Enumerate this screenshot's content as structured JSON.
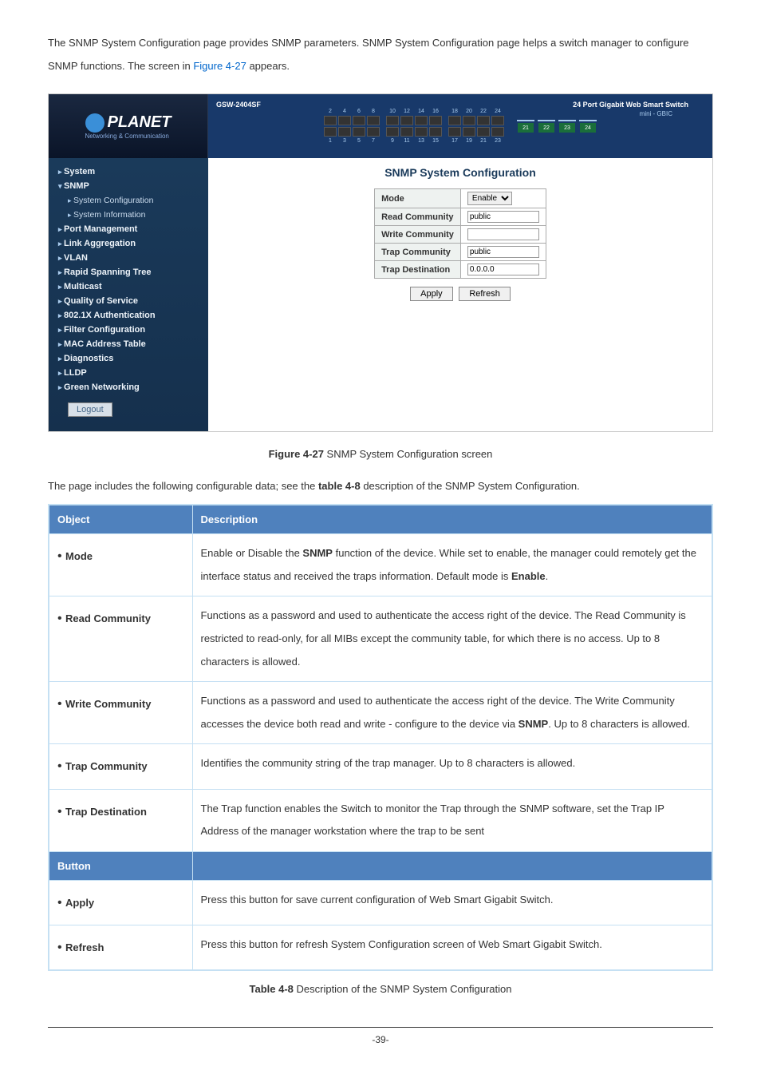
{
  "intro": {
    "text_before": "The SNMP System Configuration page provides SNMP parameters. SNMP System Configuration page helps a switch manager to configure SNMP functions. The screen in ",
    "link": "Figure 4-27",
    "text_after": " appears."
  },
  "screenshot": {
    "model": "GSW-2404SF",
    "header_title": "24 Port Gigabit Web Smart Switch",
    "header_sub": "mini - GBIC",
    "logo_text": "PLANET",
    "logo_sub": "Networking & Communication",
    "port_numbers_top": [
      "2",
      "4",
      "6",
      "8",
      "10",
      "12",
      "14",
      "16",
      "18",
      "20",
      "22",
      "24"
    ],
    "port_numbers_bottom": [
      "1",
      "3",
      "5",
      "7",
      "9",
      "11",
      "13",
      "15",
      "17",
      "19",
      "21",
      "23"
    ],
    "gbic_labels": [
      "21",
      "22",
      "23",
      "24"
    ],
    "nav": [
      {
        "label": "System",
        "expanded": false
      },
      {
        "label": "SNMP",
        "expanded": true
      },
      {
        "label": "System Configuration",
        "sub": true
      },
      {
        "label": "System Information",
        "sub": true
      },
      {
        "label": "Port Management"
      },
      {
        "label": "Link Aggregation"
      },
      {
        "label": "VLAN"
      },
      {
        "label": "Rapid Spanning Tree"
      },
      {
        "label": "Multicast"
      },
      {
        "label": "Quality of Service"
      },
      {
        "label": "802.1X Authentication"
      },
      {
        "label": "Filter Configuration"
      },
      {
        "label": "MAC Address Table"
      },
      {
        "label": "Diagnostics"
      },
      {
        "label": "LLDP"
      },
      {
        "label": "Green Networking"
      }
    ],
    "logout_label": "Logout",
    "content": {
      "title": "SNMP System Configuration",
      "rows": [
        {
          "label": "Mode",
          "type": "select",
          "value": "Enable"
        },
        {
          "label": "Read Community",
          "type": "input",
          "value": "public"
        },
        {
          "label": "Write Community",
          "type": "input",
          "value": ""
        },
        {
          "label": "Trap Community",
          "type": "input",
          "value": "public"
        },
        {
          "label": "Trap Destination",
          "type": "input",
          "value": "0.0.0.0"
        }
      ],
      "apply_btn": "Apply",
      "refresh_btn": "Refresh"
    }
  },
  "figure_caption": {
    "label": "Figure 4-27",
    "text": " SNMP System Configuration screen"
  },
  "table_intro": {
    "before": "The page includes the following configurable data; see the ",
    "label": "table 4-8",
    "after": " description of the SNMP System Configuration."
  },
  "desc_table": {
    "headers": [
      "Object",
      "Description"
    ],
    "rows": [
      {
        "obj": "Mode",
        "desc_parts": [
          "Enable or Disable the ",
          {
            "bold": "SNMP"
          },
          " function of the device. While set to enable, the manager could remotely get the interface status and received the traps information. Default mode is ",
          {
            "bold": "Enable"
          },
          "."
        ]
      },
      {
        "obj": "Read Community",
        "desc_parts": [
          "Functions as a password and used to authenticate the access right of the device. The Read Community is restricted to read-only, for all MIBs except the community table, for which there is no access. Up to 8 characters is allowed."
        ]
      },
      {
        "obj": "Write Community",
        "desc_parts": [
          "Functions as a password and used to authenticate the access right of the device. The Write Community accesses the device both  read and write - configure to the device via ",
          {
            "bold": "SNMP"
          },
          ". Up to 8 characters is allowed."
        ]
      },
      {
        "obj": "Trap Community",
        "desc_parts": [
          "Identifies the community string of the trap manager. Up to 8 characters is allowed."
        ]
      },
      {
        "obj": "Trap Destination",
        "desc_parts": [
          "The Trap function enables the Switch to monitor the Trap through the SNMP software, set the Trap IP Address of the manager workstation where the trap to be sent"
        ]
      }
    ],
    "button_header": "Button",
    "button_rows": [
      {
        "obj": "Apply",
        "desc": "Press this button for save current configuration of Web Smart Gigabit Switch."
      },
      {
        "obj": "Refresh",
        "desc": "Press this button for refresh System Configuration screen of Web Smart Gigabit Switch."
      }
    ]
  },
  "footer_caption": {
    "label": "Table 4-8",
    "text": " Description of the SNMP System Configuration"
  },
  "page_number": "-39-"
}
